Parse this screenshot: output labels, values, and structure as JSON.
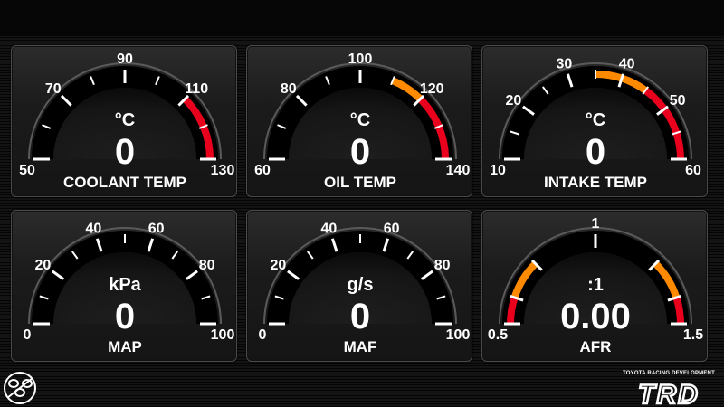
{
  "gauges": [
    {
      "id": "coolant",
      "name": "COOLANT TEMP",
      "unit": "°C",
      "value": "0",
      "min": 50,
      "max": 130,
      "labels": [
        {
          "text": "50",
          "v": 50
        },
        {
          "text": "70",
          "v": 70
        },
        {
          "text": "90",
          "v": 90
        },
        {
          "text": "110",
          "v": 110
        },
        {
          "text": "130",
          "v": 130
        }
      ],
      "majors": [
        50,
        70,
        90,
        110,
        130
      ],
      "minors": [
        60,
        80,
        100,
        120
      ],
      "zones": [
        {
          "from": 110,
          "to": 130,
          "color": "#e8001c"
        }
      ]
    },
    {
      "id": "oil",
      "name": "OIL TEMP",
      "unit": "°C",
      "value": "0",
      "min": 60,
      "max": 140,
      "labels": [
        {
          "text": "60",
          "v": 60
        },
        {
          "text": "80",
          "v": 80
        },
        {
          "text": "100",
          "v": 100
        },
        {
          "text": "120",
          "v": 120
        },
        {
          "text": "140",
          "v": 140
        }
      ],
      "majors": [
        60,
        80,
        100,
        120,
        140
      ],
      "minors": [
        70,
        90,
        110,
        130
      ],
      "zones": [
        {
          "from": 110,
          "to": 120,
          "color": "#ff8a00"
        },
        {
          "from": 120,
          "to": 140,
          "color": "#e8001c"
        }
      ]
    },
    {
      "id": "intake",
      "name": "INTAKE TEMP",
      "unit": "°C",
      "value": "0",
      "min": 10,
      "max": 60,
      "labels": [
        {
          "text": "10",
          "v": 10
        },
        {
          "text": "20",
          "v": 20
        },
        {
          "text": "30",
          "v": 30
        },
        {
          "text": "40",
          "v": 40
        },
        {
          "text": "50",
          "v": 50
        },
        {
          "text": "60",
          "v": 60
        }
      ],
      "majors": [
        10,
        20,
        30,
        40,
        50,
        60
      ],
      "minors": [
        15,
        25,
        35,
        45,
        55
      ],
      "zones": [
        {
          "from": 35,
          "to": 45,
          "color": "#ff8a00"
        },
        {
          "from": 45,
          "to": 60,
          "color": "#e8001c"
        }
      ]
    },
    {
      "id": "map",
      "name": "MAP",
      "unit": "kPa",
      "value": "0",
      "min": 0,
      "max": 100,
      "labels": [
        {
          "text": "0",
          "v": 0
        },
        {
          "text": "20",
          "v": 20
        },
        {
          "text": "40",
          "v": 40
        },
        {
          "text": "60",
          "v": 60
        },
        {
          "text": "80",
          "v": 80
        },
        {
          "text": "100",
          "v": 100
        }
      ],
      "majors": [
        0,
        20,
        40,
        60,
        80,
        100
      ],
      "minors": [
        10,
        30,
        50,
        70,
        90
      ],
      "zones": []
    },
    {
      "id": "maf",
      "name": "MAF",
      "unit": "g/s",
      "value": "0",
      "min": 0,
      "max": 100,
      "labels": [
        {
          "text": "0",
          "v": 0
        },
        {
          "text": "20",
          "v": 20
        },
        {
          "text": "40",
          "v": 40
        },
        {
          "text": "60",
          "v": 60
        },
        {
          "text": "80",
          "v": 80
        },
        {
          "text": "100",
          "v": 100
        }
      ],
      "majors": [
        0,
        20,
        40,
        60,
        80,
        100
      ],
      "minors": [
        10,
        30,
        50,
        70,
        90
      ],
      "zones": []
    },
    {
      "id": "afr",
      "name": "AFR",
      "unit": ":1",
      "value": "0.00",
      "min": 0.5,
      "max": 1.5,
      "labels": [
        {
          "text": "0.5",
          "v": 0.5
        },
        {
          "text": "1",
          "v": 1.0
        },
        {
          "text": "1.5",
          "v": 1.5
        }
      ],
      "majors": [
        0.5,
        0.6,
        0.75,
        1.0,
        1.25,
        1.4,
        1.5
      ],
      "minors": [],
      "zones": [
        {
          "from": 0.5,
          "to": 0.6,
          "color": "#e8001c"
        },
        {
          "from": 0.6,
          "to": 0.75,
          "color": "#ff8a00"
        },
        {
          "from": 1.25,
          "to": 1.4,
          "color": "#ff8a00"
        },
        {
          "from": 1.4,
          "to": 1.5,
          "color": "#e8001c"
        }
      ]
    }
  ],
  "branding": {
    "left_logo": "86-logo",
    "trd_tagline": "TOYOTA RACING DEVELOPMENT",
    "trd_logo": "TRD"
  }
}
